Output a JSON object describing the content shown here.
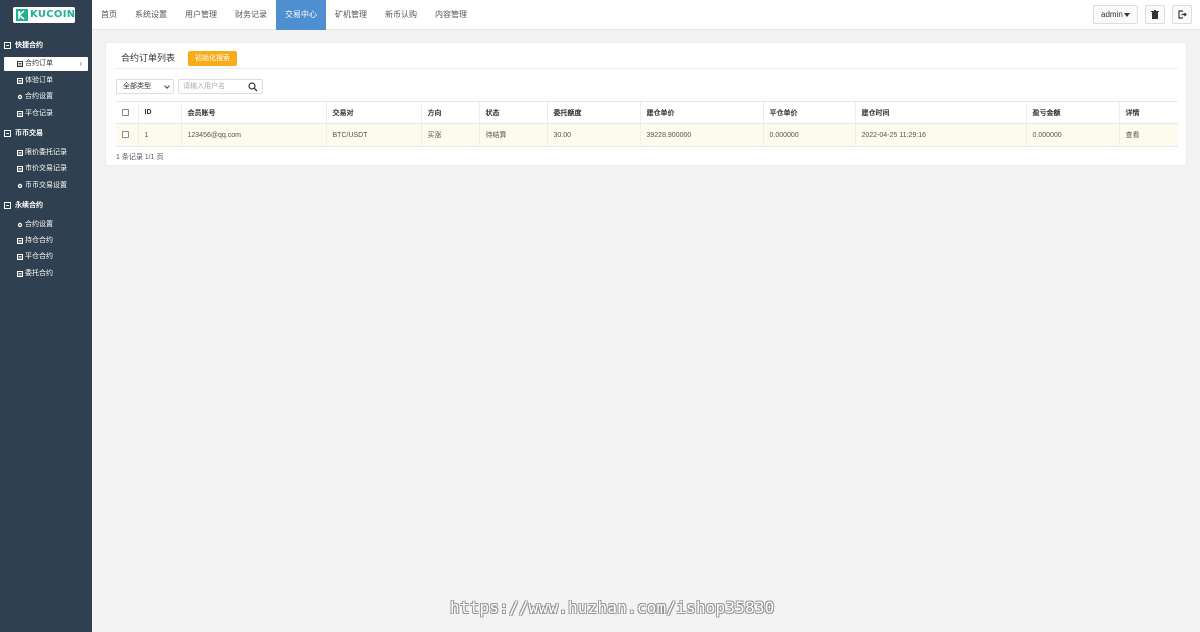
{
  "brand": {
    "name": "KUCOIN",
    "color": "#23af91"
  },
  "colors": {
    "sidebar": "#2f4050",
    "nav_active": "#4d8fd0",
    "reset_button": "#f8ac1b",
    "buy": "#1ab394"
  },
  "nav": {
    "items": [
      {
        "label": "首页"
      },
      {
        "label": "系统设置"
      },
      {
        "label": "用户管理"
      },
      {
        "label": "财务记录"
      },
      {
        "label": "交易中心"
      },
      {
        "label": "矿机管理"
      },
      {
        "label": "新币认购"
      },
      {
        "label": "内容管理"
      }
    ],
    "active": "交易中心"
  },
  "topright": {
    "user": "admin"
  },
  "sidebar": {
    "groups": [
      {
        "label": "快捷合约",
        "items": [
          {
            "label": "合约订单",
            "icon": "list-icon",
            "active": true
          },
          {
            "label": "体验订单",
            "icon": "list-icon"
          },
          {
            "label": "合约设置",
            "icon": "gear-icon"
          },
          {
            "label": "平仓记录",
            "icon": "list-icon"
          }
        ]
      },
      {
        "label": "币币交易",
        "items": [
          {
            "label": "限价委托记录",
            "icon": "list-icon"
          },
          {
            "label": "市价交易记录",
            "icon": "list-icon"
          },
          {
            "label": "币币交易设置",
            "icon": "gear-icon"
          }
        ]
      },
      {
        "label": "永续合约",
        "items": [
          {
            "label": "合约设置",
            "icon": "gear-icon"
          },
          {
            "label": "持仓合约",
            "icon": "list-icon"
          },
          {
            "label": "平仓合约",
            "icon": "list-icon"
          },
          {
            "label": "委托合约",
            "icon": "list-icon"
          }
        ]
      }
    ]
  },
  "panel": {
    "title": "合约订单列表",
    "reset_label": "初始化搜索",
    "filter": {
      "type_value": "全部类型",
      "search_placeholder": "请输入用户名"
    },
    "columns": [
      "ID",
      "会员账号",
      "交易对",
      "方向",
      "状态",
      "委托额度",
      "建仓单价",
      "平仓单价",
      "建仓时间",
      "盈亏金额",
      "详情"
    ],
    "rows": [
      {
        "id": "1",
        "account": "123456@qq.com",
        "pair": "BTC/USDT",
        "direction": "买涨",
        "status": "待结算",
        "amount": "30.00",
        "open_price": "39228.900000",
        "close_price": "0.000000",
        "open_time": "2022-04-25 11:29:16",
        "pnl": "0.000000",
        "detail": "查看"
      }
    ],
    "pager": "1 条记录 1/1 页"
  },
  "watermark": "https://www.huzhan.com/ishop35830"
}
